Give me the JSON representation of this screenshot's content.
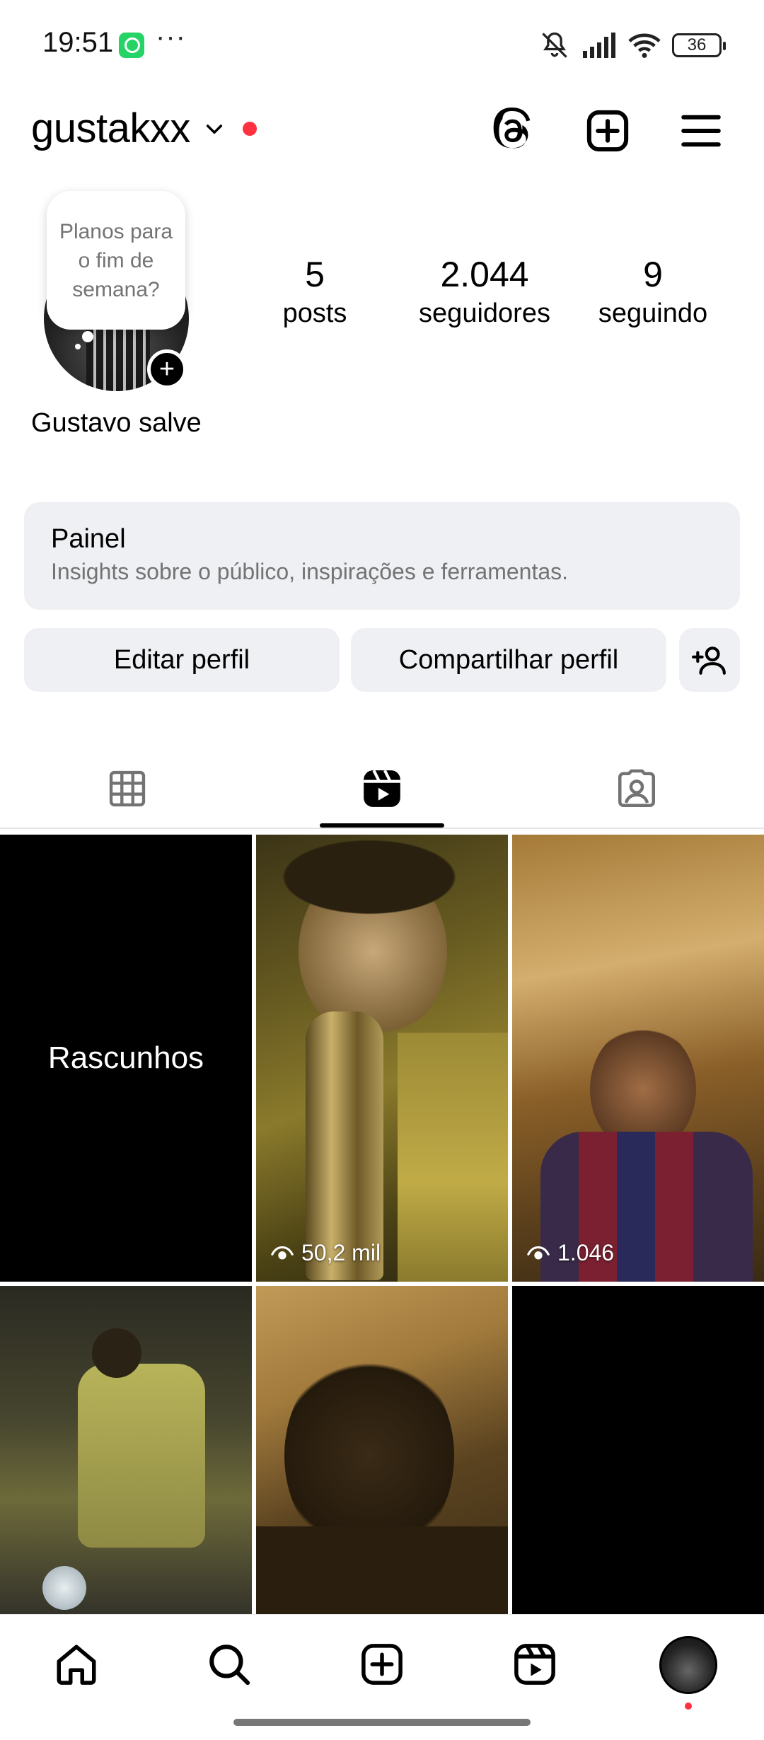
{
  "status_bar": {
    "time": "19:51",
    "more": "···",
    "battery": "36",
    "icons": [
      "whatsapp-icon",
      "mute-icon",
      "signal-icon",
      "wifi-icon",
      "battery-icon"
    ]
  },
  "header": {
    "username": "gustakxx",
    "icons": [
      "chevron-down-icon",
      "threads-icon",
      "add-post-icon",
      "menu-icon"
    ],
    "notification_color": "#ff3040"
  },
  "profile": {
    "note": "Planos para o fim de semana?",
    "display_name": "Gustavo salve",
    "stats": [
      {
        "value": "5",
        "label": "posts"
      },
      {
        "value": "2.044",
        "label": "seguidores"
      },
      {
        "value": "9",
        "label": "seguindo"
      }
    ]
  },
  "dashboard": {
    "title": "Painel",
    "subtitle": "Insights sobre o público, inspirações e ferramentas."
  },
  "buttons": {
    "edit": "Editar perfil",
    "share": "Compartilhar perfil"
  },
  "tabs": [
    {
      "name": "grid-icon",
      "active": false
    },
    {
      "name": "reels-icon",
      "active": true
    },
    {
      "name": "tagged-icon",
      "active": false
    }
  ],
  "grid": {
    "drafts_label": "Rascunhos",
    "items": [
      {
        "views": "50,2 mil"
      },
      {
        "views": "1.046"
      }
    ]
  },
  "bottom_nav": [
    "home-icon",
    "search-icon",
    "create-icon",
    "reels-icon",
    "profile-avatar"
  ]
}
